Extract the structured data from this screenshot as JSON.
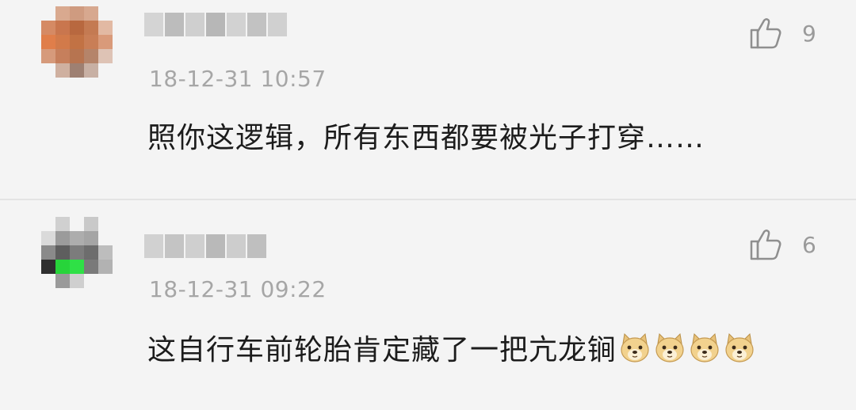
{
  "comments": [
    {
      "timestamp": "18-12-31 10:57",
      "likes": "9",
      "content": "照你这逻辑，所有东西都要被光子打穿……",
      "emojis": []
    },
    {
      "timestamp": "18-12-31 09:22",
      "likes": "6",
      "content": "这自行车前轮胎肯定藏了一把亢龙锏",
      "emojis": [
        "doge-emoji",
        "doge-emoji",
        "doge-emoji",
        "doge-emoji"
      ]
    }
  ],
  "colors": {
    "background": "#f4f4f4",
    "text": "#1c1c1c",
    "meta": "#a6a6a6",
    "divider": "#e4e4e4"
  },
  "icons": {
    "like": "thumbs-up-icon",
    "emoji": "doge-emoji"
  }
}
